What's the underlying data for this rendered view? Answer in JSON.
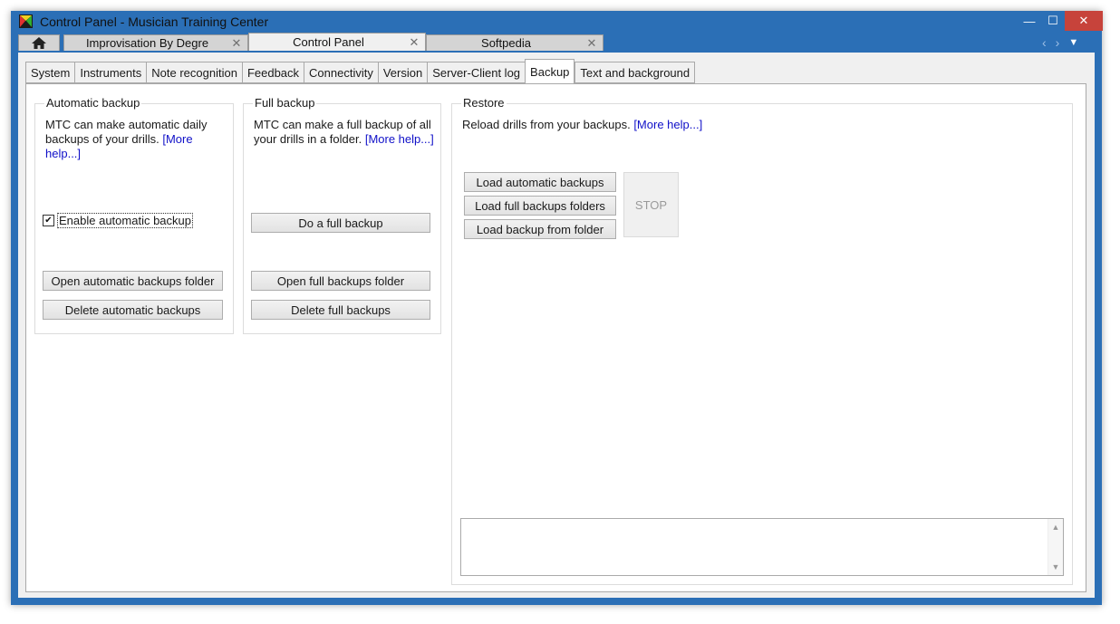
{
  "window": {
    "title": "Control Panel - Musician Training Center",
    "controls": {
      "minimize": "—",
      "maximize": "☐",
      "close": "✕"
    }
  },
  "doc_tabs": [
    {
      "label": "Improvisation By Degre",
      "close": "✕"
    },
    {
      "label": "Control Panel",
      "close": "✕"
    },
    {
      "label": "Softpedia",
      "close": "✕"
    }
  ],
  "nav": {
    "prev": "‹",
    "next": "›",
    "menu": "▼"
  },
  "sub_tabs": [
    "System",
    "Instruments",
    "Note recognition",
    "Feedback",
    "Connectivity",
    "Version",
    "Server-Client log",
    "Backup",
    "Text and background"
  ],
  "active_sub_tab": "Backup",
  "automatic_backup": {
    "title": "Automatic backup",
    "desc": "MTC can make automatic daily backups of your drills. ",
    "more_help": "[More help...]",
    "enable_checkbox": {
      "label": "Enable automatic backup",
      "checked": true,
      "mark": "✔"
    },
    "open_button": "Open automatic backups folder",
    "delete_button": "Delete automatic backups"
  },
  "full_backup": {
    "title": "Full backup",
    "desc": "MTC can make a full backup of all your drills in a folder. ",
    "more_help": "[More help...]",
    "do_button": "Do a full backup",
    "open_button": "Open full backups folder",
    "delete_button": "Delete full backups"
  },
  "restore": {
    "title": "Restore",
    "desc": "Reload drills from your backups. ",
    "more_help": "[More help...]",
    "load_auto_button": "Load automatic backups",
    "load_full_button": "Load full backups folders",
    "load_folder_button": "Load backup from folder",
    "stop_button": "STOP",
    "log_text": ""
  },
  "icons": {
    "app": "mtc-logo-icon",
    "home": "home-icon"
  },
  "colors": {
    "window_frame": "#2b6fb6",
    "close": "#c7433b",
    "link": "#1010c8"
  }
}
